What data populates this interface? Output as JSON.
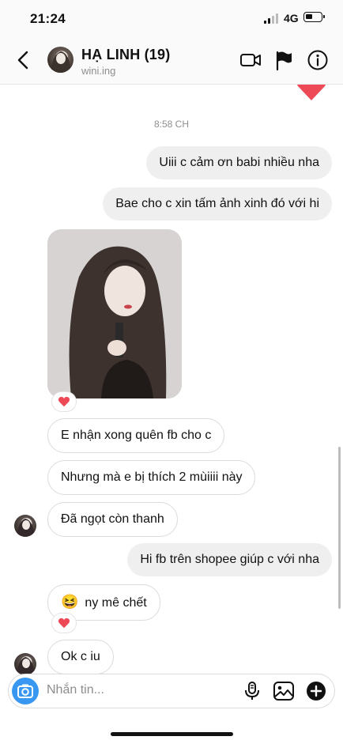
{
  "status_bar": {
    "time": "21:24",
    "network": "4G"
  },
  "header": {
    "name": "HẠ LINH (19)",
    "username": "wini.ing"
  },
  "thread": {
    "timestamp": "8:58 CH",
    "messages": [
      {
        "side": "sent",
        "text": "Uiii c cảm ơn babi nhiều nha"
      },
      {
        "side": "sent",
        "text": "Bae cho c xin tấm ảnh xinh đó với hi"
      },
      {
        "side": "recv",
        "type": "photo",
        "reaction": "heart"
      },
      {
        "side": "recv",
        "text": "E nhận xong quên fb cho c"
      },
      {
        "side": "recv",
        "text": "Nhưng mà e bị thích 2 mùiiii này"
      },
      {
        "side": "recv",
        "text": "Đã ngọt còn thanh"
      },
      {
        "side": "sent",
        "text": "Hi fb trên shopee giúp c với nha"
      },
      {
        "side": "recv",
        "emoji": "😆",
        "text": "ny mê chết",
        "reaction": "heart"
      },
      {
        "side": "recv",
        "text": "Ok c iu"
      }
    ]
  },
  "composer": {
    "placeholder": "Nhắn tin..."
  },
  "colors": {
    "heart": "#ed4956",
    "accent": "#3897f0",
    "sent_bubble": "#efefef",
    "border": "#dbdbdb"
  }
}
